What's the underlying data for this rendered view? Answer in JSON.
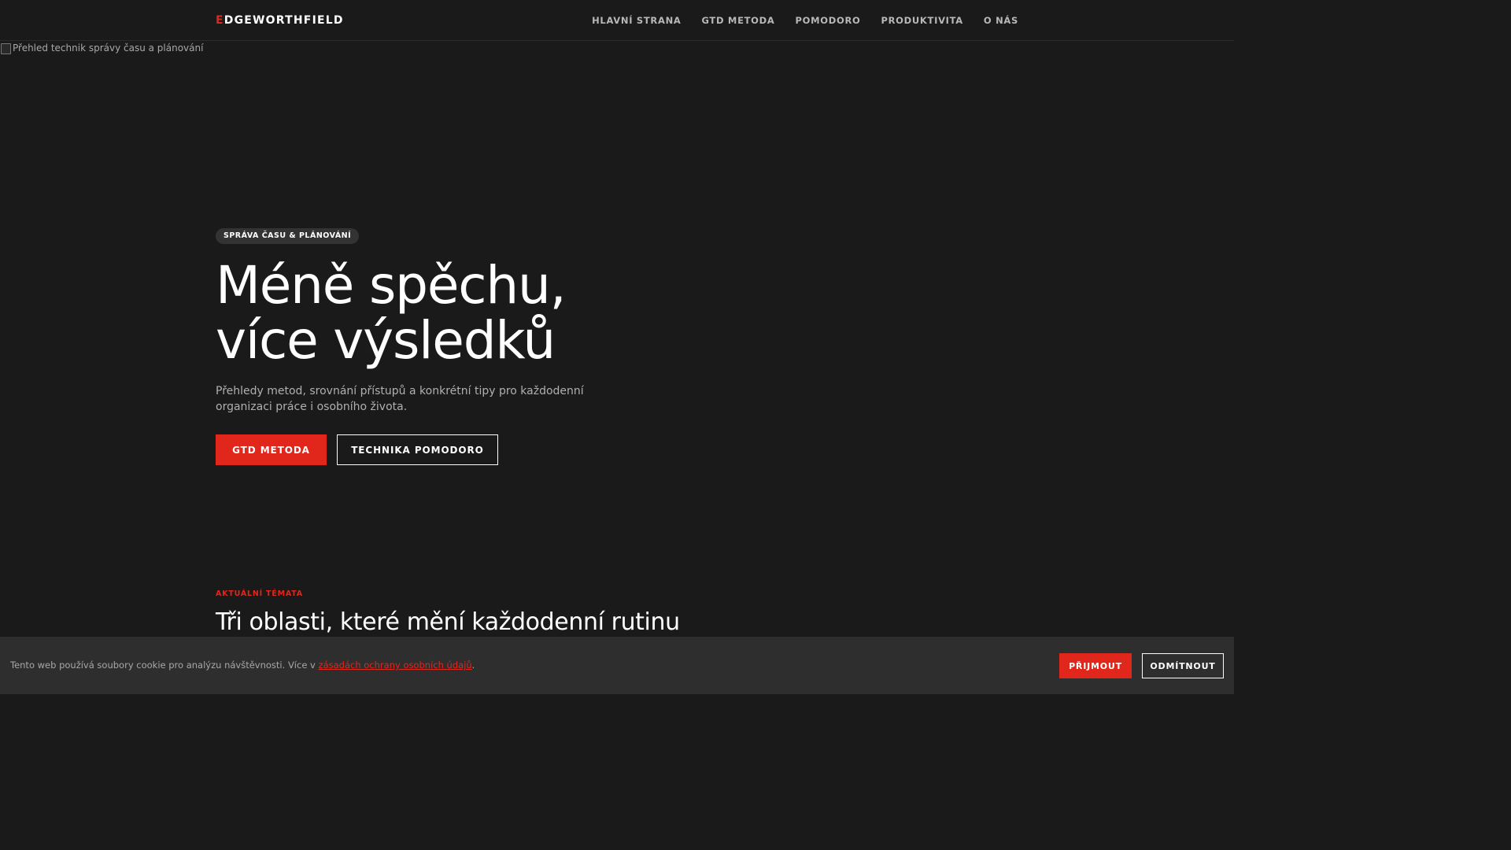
{
  "header": {
    "logo_first_letter": "E",
    "logo_rest": "DGEWORTHFIELD",
    "nav": [
      {
        "label": "HLAVNÍ STRANA"
      },
      {
        "label": "GTD METODA"
      },
      {
        "label": "POMODORO"
      },
      {
        "label": "PRODUKTIVITA"
      },
      {
        "label": "O NÁS"
      }
    ]
  },
  "hero": {
    "image_alt": "Přehled technik správy času a plánování",
    "badge": "SPRÁVA ČASU & PLÁNOVÁNÍ",
    "title_line1": "Méně spěchu,",
    "title_line2": "více výsledků",
    "subtitle": "Přehledy metod, srovnání přístupů a konkrétní tipy pro každodenní organizaci práce i osobního života.",
    "primary_button": "GTD METODA",
    "secondary_button": "TECHNIKA POMODORO"
  },
  "section": {
    "eyebrow": "AKTUÁLNÍ TÉMATA",
    "title": "Tři oblasti, které mění každodenní rutinu"
  },
  "cookie": {
    "text_before": "Tento web používá soubory cookie pro analýzu návštěvnosti. Více v ",
    "link": "zásadách ochrany osobních údajů",
    "text_after": ".",
    "accept": "PŘIJMOUT",
    "decline": "ODMÍTNOUT"
  },
  "colors": {
    "background": "#1a1a1a",
    "accent": "#e1261c",
    "banner": "#2e2e2e"
  }
}
